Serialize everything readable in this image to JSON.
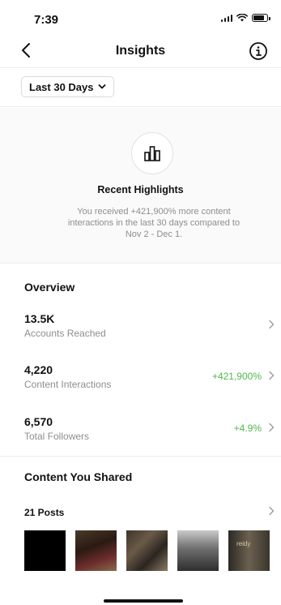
{
  "status_bar": {
    "time": "7:39",
    "battery_level": 0.8
  },
  "nav": {
    "title": "Insights",
    "back_icon": "chevron-left-icon",
    "info_icon": "info-icon"
  },
  "date_range": {
    "label": "Last 30 Days"
  },
  "highlights": {
    "title": "Recent Highlights",
    "line1": "You received +421,900% more content",
    "line2": "interactions in the last 30 days compared to",
    "line3": "Nov 2 - Dec 1.",
    "icon": "bar-chart-icon"
  },
  "overview": {
    "title": "Overview",
    "rows": [
      {
        "value": "13.5K",
        "label": "Accounts Reached",
        "change": ""
      },
      {
        "value": "4,220",
        "label": "Content Interactions",
        "change": "+421,900%"
      },
      {
        "value": "6,570",
        "label": "Total Followers",
        "change": "+4.9%"
      }
    ]
  },
  "content_shared": {
    "title": "Content You Shared",
    "posts_label": "21 Posts",
    "thumb_5_text": "reidy"
  },
  "colors": {
    "positive": "#4fba4a",
    "muted": "#8e8e8e"
  }
}
